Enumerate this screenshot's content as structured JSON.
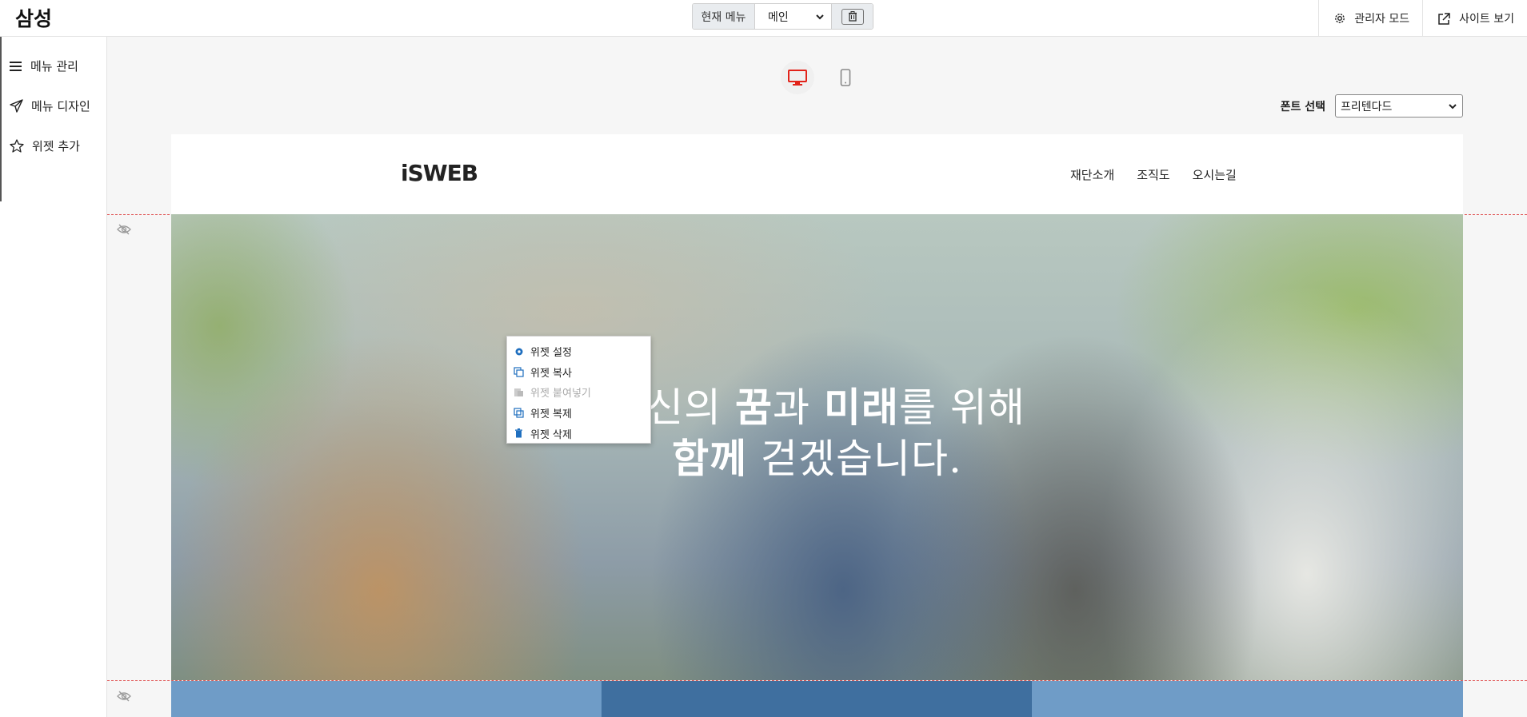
{
  "topbar": {
    "brand": "삼성",
    "current_menu_label": "현재 메뉴",
    "current_menu_value": "메인",
    "admin_mode": "관리자 모드",
    "view_site": "사이트 보기"
  },
  "sidebar": {
    "items": [
      {
        "label": "메뉴 관리",
        "icon": "hamburger-icon"
      },
      {
        "label": "메뉴 디자인",
        "icon": "paper-plane-icon"
      },
      {
        "label": "위젯 추가",
        "icon": "star-icon"
      }
    ]
  },
  "editor": {
    "devices": [
      "desktop",
      "mobile"
    ],
    "active_device": "desktop",
    "font_label": "폰트 선택",
    "font_value": "프리텐다드"
  },
  "preview": {
    "logo": "iSWEB",
    "nav": [
      "재단소개",
      "조직도",
      "오시는길"
    ],
    "hero": {
      "line1_pre": "당신의 ",
      "line1_b1": "꿈",
      "line1_mid": "과 ",
      "line1_b2": "미래",
      "line1_post": "를 위해",
      "line2_b": "함께",
      "line2_post": " 걷겠습니다."
    }
  },
  "context_menu": {
    "items": [
      {
        "label": "위젯 설정",
        "icon": "gear-icon",
        "enabled": true
      },
      {
        "label": "위젯 복사",
        "icon": "copy-icon",
        "enabled": true
      },
      {
        "label": "위젯 붙여넣기",
        "icon": "paste-icon",
        "enabled": false
      },
      {
        "label": "위젯 복제",
        "icon": "duplicate-icon",
        "enabled": true
      },
      {
        "label": "위젯 삭제",
        "icon": "trash-icon",
        "enabled": true
      }
    ]
  },
  "colors": {
    "accent_red": "#e2231a",
    "guide_line": "#e05555",
    "icon_blue": "#1f6fbf",
    "band_light": "#6f9cc7",
    "band_dark": "#3f6f9f"
  }
}
